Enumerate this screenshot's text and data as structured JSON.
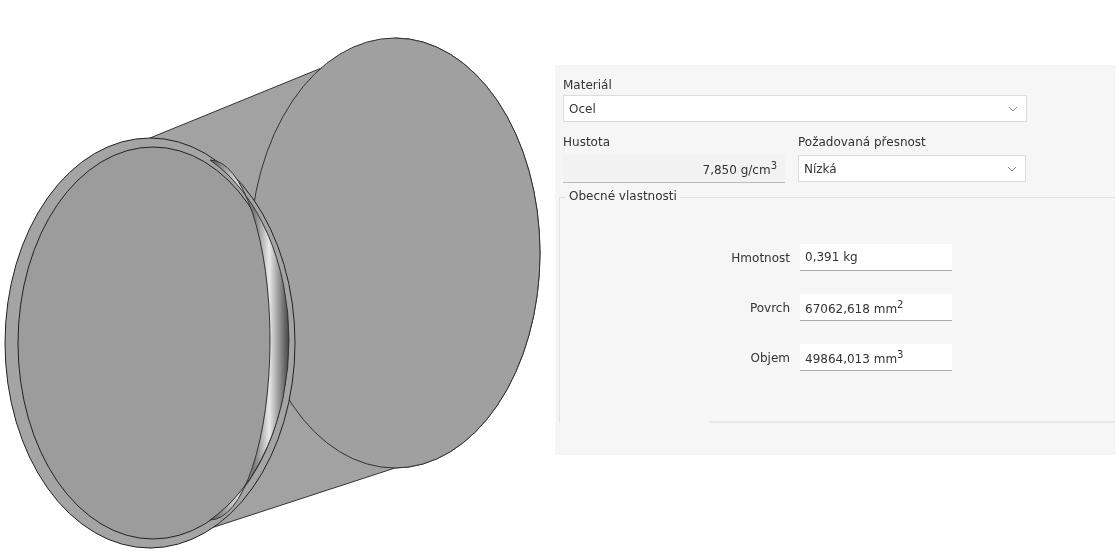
{
  "material": {
    "label": "Materiál",
    "value": "Ocel"
  },
  "density": {
    "label": "Hustota",
    "value": "7,850 g/cm$^{3}$"
  },
  "accuracy": {
    "label": "Požadovaná přesnost",
    "value": "Nízká"
  },
  "general_properties": {
    "title": "Obecné vlastnosti",
    "rows": [
      {
        "label": "Hmotnost",
        "value": "0,391 kg"
      },
      {
        "label": "Povrch",
        "value": "67062,618 mm$^{2}$"
      },
      {
        "label": "Objem",
        "value": "49864,013 mm$^{3}$"
      }
    ]
  }
}
